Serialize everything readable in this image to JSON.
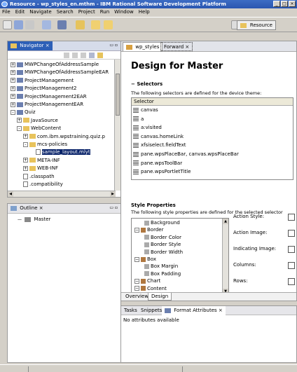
{
  "window": {
    "title": "Resource - wp_styles_en.mthm - IBM Rational Software Development Platform"
  },
  "menu": [
    "File",
    "Edit",
    "Navigate",
    "Search",
    "Project",
    "Run",
    "Window",
    "Help"
  ],
  "toolbar": {
    "perspective_label": "Resource"
  },
  "navigator": {
    "tab_label": "Navigator",
    "items": [
      {
        "label": "MWPChangeOfAddressSample",
        "type": "project",
        "depth": 0,
        "expander": "+"
      },
      {
        "label": "MWPChangeOfAddressSampleEAR",
        "type": "project",
        "depth": 0,
        "expander": "+"
      },
      {
        "label": "ProjectManagement",
        "type": "project",
        "depth": 0,
        "expander": "+"
      },
      {
        "label": "ProjectManagement2",
        "type": "project",
        "depth": 0,
        "expander": "+"
      },
      {
        "label": "ProjectManagement2EAR",
        "type": "project",
        "depth": 0,
        "expander": "+"
      },
      {
        "label": "ProjectManagementEAR",
        "type": "project",
        "depth": 0,
        "expander": "+"
      },
      {
        "label": "Quiz",
        "type": "project",
        "depth": 0,
        "expander": "-"
      },
      {
        "label": "JavaSource",
        "type": "folder",
        "depth": 1,
        "expander": "+"
      },
      {
        "label": "WebContent",
        "type": "folder",
        "depth": 1,
        "expander": "-"
      },
      {
        "label": "com.ibm.wpstraining.quiz.p",
        "type": "folder",
        "depth": 2,
        "expander": "+"
      },
      {
        "label": "mcs-policies",
        "type": "folder",
        "depth": 2,
        "expander": "-"
      },
      {
        "label": "sample_layout.mlyt",
        "type": "file",
        "depth": 3,
        "expander": "",
        "selected": true
      },
      {
        "label": "META-INF",
        "type": "folder",
        "depth": 2,
        "expander": "+"
      },
      {
        "label": "WEB-INF",
        "type": "folder",
        "depth": 2,
        "expander": "+"
      },
      {
        "label": ".classpath",
        "type": "file",
        "depth": 1,
        "expander": ""
      },
      {
        "label": ".compatibility",
        "type": "file",
        "depth": 1,
        "expander": ""
      }
    ]
  },
  "outline": {
    "tab_label": "Outline",
    "items": [
      "Master"
    ]
  },
  "editor": {
    "tabs": [
      {
        "label": "wp_styles"
      },
      {
        "label": "Forward"
      }
    ],
    "heading": "Design for Master",
    "selectors": {
      "section_title": "Selectors",
      "description": "The following selectors are defined for the device theme:",
      "column_header": "Selector",
      "items": [
        "canvas",
        "a",
        "a:visited",
        "canvas.homeLink",
        "xfsiselect.fieldText",
        "pane.wpsPlaceBar, canvas.wpsPlaceBar",
        "pane.wpsToolBar",
        "pane.wpsPortletTitle"
      ]
    },
    "style_properties": {
      "title": "Style Properties",
      "description": "The following style properties are defined for the selected selector",
      "tree": [
        {
          "label": "Background",
          "depth": 1
        },
        {
          "label": "Border",
          "depth": 0
        },
        {
          "label": "Border Color",
          "depth": 1
        },
        {
          "label": "Border Style",
          "depth": 1
        },
        {
          "label": "Border Width",
          "depth": 1
        },
        {
          "label": "Box",
          "depth": 0
        },
        {
          "label": "Box Margin",
          "depth": 1
        },
        {
          "label": "Box Padding",
          "depth": 1
        },
        {
          "label": "Chart",
          "depth": 0
        },
        {
          "label": "Content",
          "depth": 0
        }
      ],
      "fields": [
        "Action Style:",
        "Action Image:",
        "Indicating Image:",
        "Columns:",
        "Rows:"
      ]
    },
    "bottom_tabs": [
      "Overview",
      "Design"
    ]
  },
  "bottom_panel": {
    "tabs": [
      "Tasks",
      "Snippets",
      "Format Attributes"
    ],
    "message": "No attributes available"
  },
  "colors": {
    "title_bar": "#2a56b0",
    "selection": "#0a246a",
    "chrome": "#d4d0c8"
  }
}
